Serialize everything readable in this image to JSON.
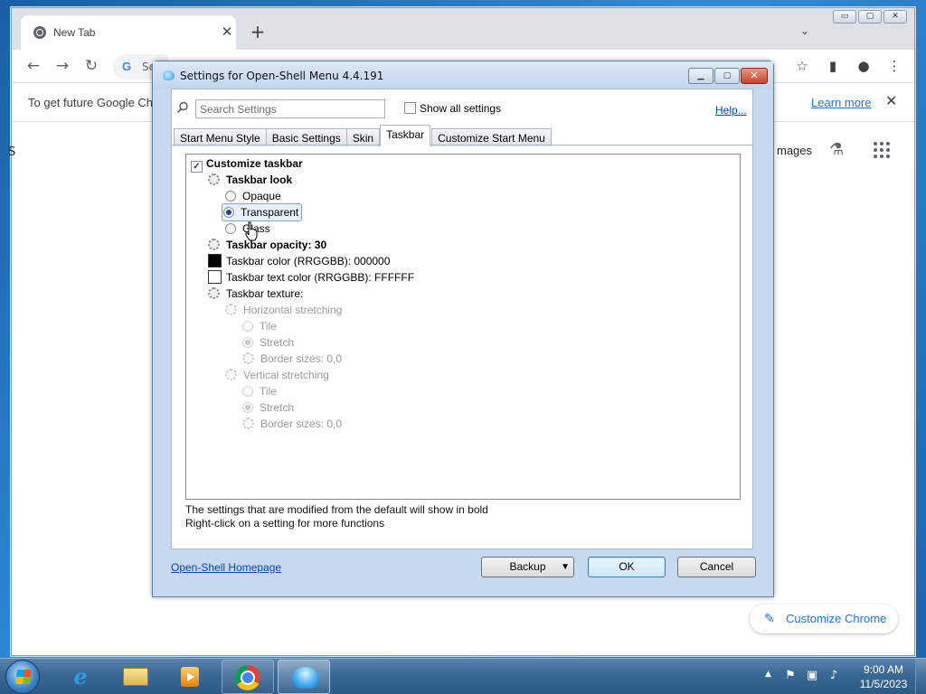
{
  "chrome": {
    "tab_title": "New Tab",
    "tab_close": "✕",
    "new_tab": "+",
    "tab_list": "⌄",
    "omnibox_g": "G",
    "omnibox_text": "Se",
    "infobar_message": "To get future Google Ch",
    "infobar_learn_more": "Learn more",
    "infobar_close": "✕",
    "ntp_images": "mages",
    "ntp_left_char": "S",
    "customize_chrome": "Customize Chrome",
    "window_buttons": [
      "▭",
      "▢",
      "✕"
    ]
  },
  "dialog": {
    "title": "Settings for Open-Shell Menu 4.4.191",
    "search_placeholder": "Search Settings",
    "show_all_label": "Show all settings",
    "help_link": "Help...",
    "tabs": [
      {
        "label": "Start Menu Style"
      },
      {
        "label": "Basic Settings"
      },
      {
        "label": "Skin"
      },
      {
        "label": "Taskbar"
      },
      {
        "label": "Customize Start Menu"
      }
    ],
    "active_tab": "Taskbar",
    "tree": {
      "customize_taskbar": "Customize taskbar",
      "customize_taskbar_checked": true,
      "taskbar_look": "Taskbar look",
      "opaque": "Opaque",
      "transparent": "Transparent",
      "glass": "Glass",
      "opacity": "Taskbar opacity: 30",
      "color": "Taskbar color (RRGGBB): 000000",
      "color_value": "#000000",
      "text_color": "Taskbar text color (RRGGBB): FFFFFF",
      "text_color_value": "#FFFFFF",
      "texture": "Taskbar texture:",
      "horizontal": "Horizontal stretching",
      "h_tile": "Tile",
      "h_stretch": "Stretch",
      "h_border": "Border sizes: 0,0",
      "vertical": "Vertical stretching",
      "v_tile": "Tile",
      "v_stretch": "Stretch",
      "v_border": "Border sizes: 0,0"
    },
    "note_line1": "The settings that are modified from the default will show in bold",
    "note_line2": "Right-click on a setting for more functions",
    "homepage_link": "Open-Shell Homepage",
    "backup_button": "Backup",
    "ok_button": "OK",
    "cancel_button": "Cancel"
  },
  "taskbar": {
    "ie_glyph": "e",
    "clock_time": "9:00 AM",
    "clock_date": "11/5/2023",
    "tray_up": "▲"
  }
}
